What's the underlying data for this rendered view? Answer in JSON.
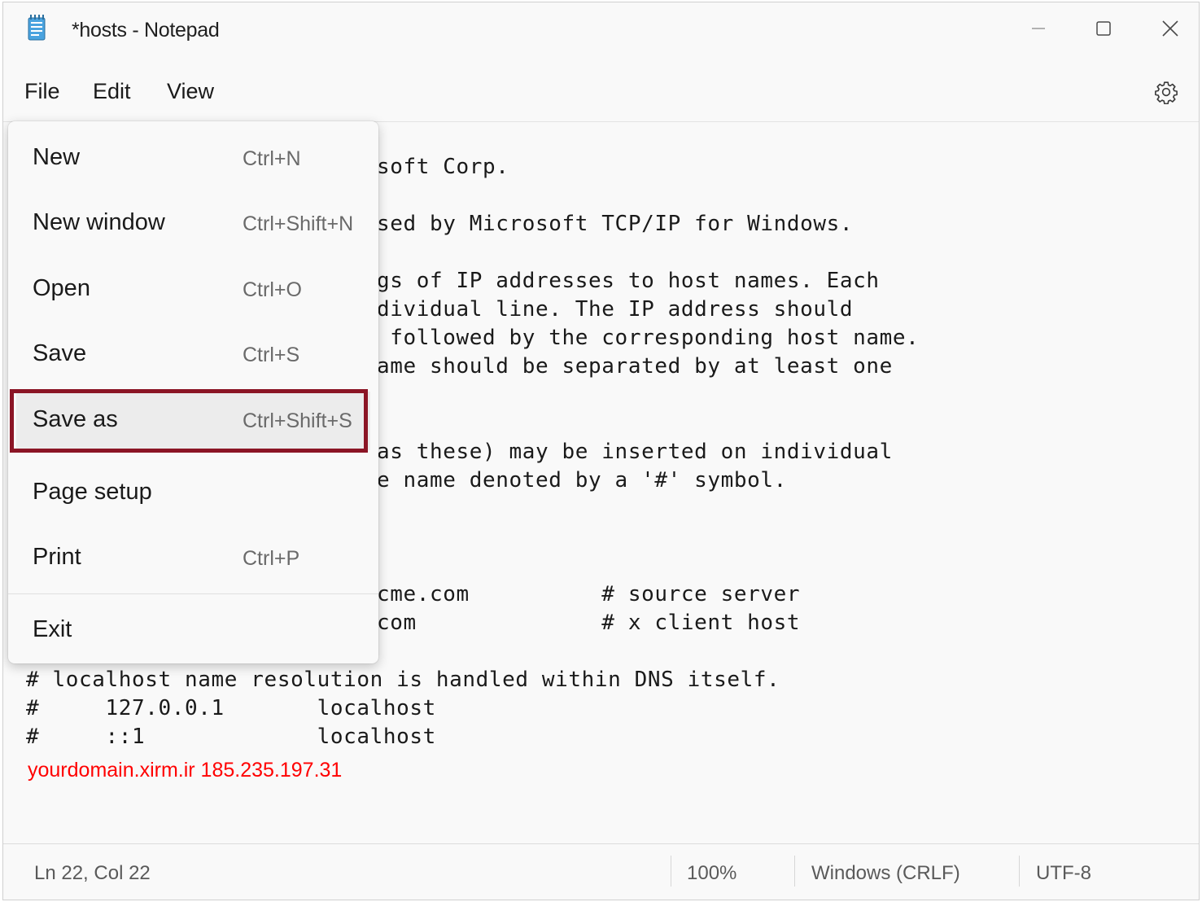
{
  "window": {
    "title": "*hosts - Notepad",
    "buttons": {
      "minimize": "minimize-icon",
      "maximize": "maximize-icon",
      "close": "close-icon"
    }
  },
  "menubar": {
    "items": [
      {
        "label": "File"
      },
      {
        "label": "Edit"
      },
      {
        "label": "View"
      }
    ],
    "settings_icon": "gear-icon"
  },
  "file_menu": {
    "items": [
      {
        "label": "New",
        "shortcut": "Ctrl+N"
      },
      {
        "label": "New window",
        "shortcut": "Ctrl+Shift+N"
      },
      {
        "label": "Open",
        "shortcut": "Ctrl+O"
      },
      {
        "label": "Save",
        "shortcut": "Ctrl+S"
      },
      {
        "label": "Save as",
        "shortcut": "Ctrl+Shift+S",
        "highlighted": true
      },
      {
        "label": "Page setup",
        "shortcut": ""
      },
      {
        "label": "Print",
        "shortcut": "Ctrl+P"
      },
      {
        "label": "Exit",
        "shortcut": ""
      }
    ],
    "highlight_color": "#8b1525"
  },
  "editor": {
    "visible_lines": [
      "soft Corp.",
      "sed by Microsoft TCP/IP for Windows.",
      "gs of IP addresses to host names. Each",
      "dividual line. The IP address should",
      " followed by the corresponding host name.",
      "ame should be separated by at least one",
      "as these) may be inserted on individual",
      "e name denoted by a '#' symbol.",
      "cme.com          # source server",
      "com              # x client host",
      "# localhost name resolution is handled within DNS itself.",
      "#     127.0.0.1       localhost",
      "#     ::1             localhost"
    ],
    "custom_entry": "yourdomain.xirm.ir 185.235.197.31",
    "custom_entry_color": "#ff0000"
  },
  "statusbar": {
    "position": "Ln 22, Col 22",
    "zoom": "100%",
    "line_ending": "Windows (CRLF)",
    "encoding": "UTF-8"
  }
}
